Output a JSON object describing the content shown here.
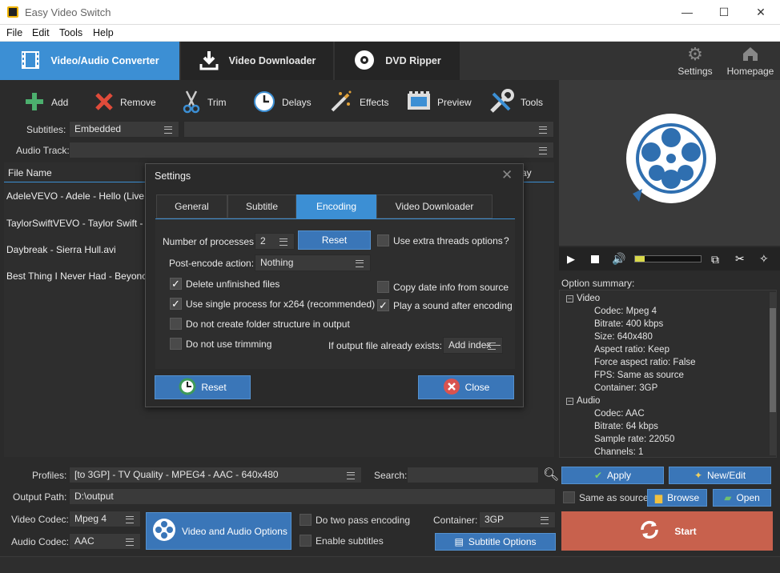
{
  "window": {
    "title": "Easy Video Switch"
  },
  "menu": [
    "File",
    "Edit",
    "Tools",
    "Help"
  ],
  "tabs": [
    {
      "label": "Video/Audio Converter",
      "active": true
    },
    {
      "label": "Video Downloader",
      "active": false
    },
    {
      "label": "DVD Ripper",
      "active": false
    }
  ],
  "nav": {
    "settings": "Settings",
    "homepage": "Homepage"
  },
  "toolbar": [
    "Add",
    "Remove",
    "Trim",
    "Delays",
    "Effects",
    "Preview",
    "Tools"
  ],
  "subtitles": {
    "label": "Subtitles:",
    "value": "Embedded"
  },
  "audio_track": {
    "label": "Audio Track:"
  },
  "file_list": {
    "header": "File Name",
    "header_right": "ay",
    "files": [
      "AdeleVEVO - Adele - Hello (Live at",
      "TaylorSwiftVEVO - Taylor Swift - W",
      "Daybreak - Sierra Hull.avi",
      "Best Thing I Never Had - Beyonce.v"
    ]
  },
  "option_summary": {
    "label": "Option summary:",
    "video_label": "Video",
    "video": [
      "Codec: Mpeg 4",
      "Bitrate: 400 kbps",
      "Size: 640x480",
      "Aspect ratio: Keep",
      "Force aspect ratio: False",
      "FPS: Same as source",
      "Container: 3GP"
    ],
    "audio_label": "Audio",
    "audio": [
      "Codec: AAC",
      "Bitrate: 64 kbps",
      "Sample rate: 22050",
      "Channels: 1"
    ]
  },
  "bottom": {
    "profiles_label": "Profiles:",
    "profile_value": "[to 3GP] - TV Quality - MPEG4 - AAC - 640x480",
    "search_label": "Search:",
    "output_label": "Output Path:",
    "output_value": "D:\\output",
    "video_codec_label": "Video Codec:",
    "video_codec": "Mpeg 4",
    "audio_codec_label": "Audio Codec:",
    "audio_codec": "AAC",
    "va_options": "Video and Audio Options",
    "two_pass": "Do two pass encoding",
    "enable_subs": "Enable subtitles",
    "container_label": "Container:",
    "container": "3GP",
    "subtitle_options": "Subtitle Options",
    "apply": "Apply",
    "new_edit": "New/Edit",
    "same_as_source": "Same as source",
    "browse": "Browse",
    "open": "Open",
    "start": "Start"
  },
  "dialog": {
    "title": "Settings",
    "tabs": [
      "General",
      "Subtitle",
      "Encoding",
      "Video Downloader"
    ],
    "active_tab": "Encoding",
    "num_processes_label": "Number of processes:",
    "num_processes": "2",
    "reset_small": "Reset",
    "extra_threads": "Use extra threads options",
    "help": "?",
    "post_encode_label": "Post-encode action:",
    "post_encode": "Nothing",
    "delete_unfinished": "Delete unfinished files",
    "single_process": "Use single process for x264 (recommended)",
    "no_folder": "Do not create folder structure in output",
    "no_trimming": "Do not use trimming",
    "copy_date": "Copy date info from source",
    "play_sound": "Play a sound after encoding",
    "exists_label": "If output file already exists:",
    "exists_value": "Add index",
    "reset": "Reset",
    "close": "Close"
  },
  "colors": {
    "accent": "#3c8fd4",
    "start": "#c8614d",
    "progress": "#d9d94a"
  },
  "progress": {
    "volume_fraction": 0.15
  }
}
